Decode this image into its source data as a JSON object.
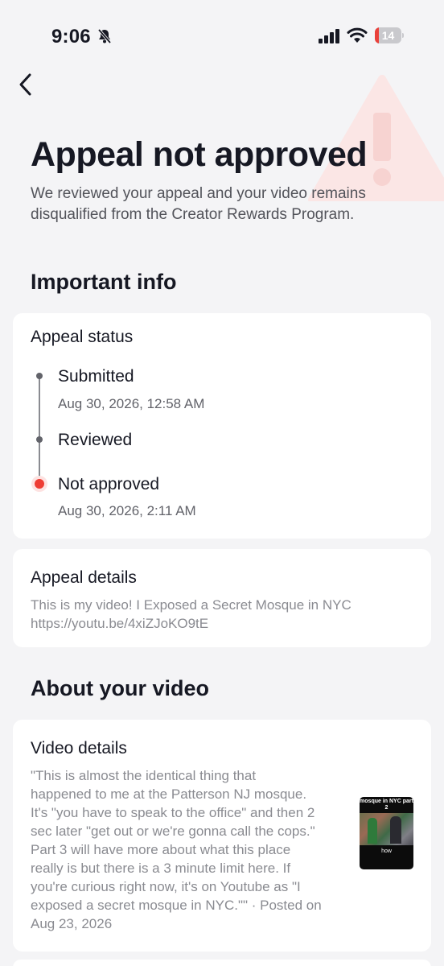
{
  "status_bar": {
    "time": "9:06",
    "battery_level": "14",
    "battery_fraction": 0.14,
    "icons": [
      "bell-slash-icon",
      "cellular-signal-icon",
      "wifi-icon",
      "battery-icon"
    ]
  },
  "header": {
    "back_icon": "chevron-left-icon",
    "decoration_icon": "warning-triangle-icon",
    "title": "Appeal not approved",
    "subtitle": "We reviewed your appeal and your video remains disqualified from the Creator Rewards Program."
  },
  "important_info": {
    "heading": "Important info",
    "appeal_status": {
      "title": "Appeal status",
      "steps": [
        {
          "label": "Submitted",
          "date": "Aug 30, 2026, 12:58 AM"
        },
        {
          "label": "Reviewed",
          "date": ""
        },
        {
          "label": "Not approved",
          "date": "Aug 30, 2026, 2:11 AM"
        }
      ]
    },
    "appeal_details": {
      "title": "Appeal details",
      "line1": "This is my video! I Exposed a Secret Mosque in NYC",
      "line2": "https://youtu.be/4xiZJoKO9tE"
    }
  },
  "about_video": {
    "heading": "About your video",
    "video_details": {
      "title": "Video details",
      "lines": [
        "\"This is almost the identical thing that",
        "happened to me at the Patterson NJ mosque.",
        "It's \"you have to speak to the office\" and then 2",
        "sec later \"get out or we're gonna call the cops.\"",
        "Part 3 will have more about what this place",
        "really is but there is a 3 minute limit here. If",
        "you're curious right now, it's on Youtube as \"I",
        "exposed a secret mosque in NYC.\"\" · Posted on",
        "Aug 23, 2026"
      ],
      "thumbnail_caption": "mosque in NYC part 2",
      "thumbnail_word": "how"
    }
  },
  "colors": {
    "background": "#f4f4f6",
    "card": "#ffffff",
    "accent_red": "#ee3d34",
    "muted_text": "#8a8b91"
  }
}
